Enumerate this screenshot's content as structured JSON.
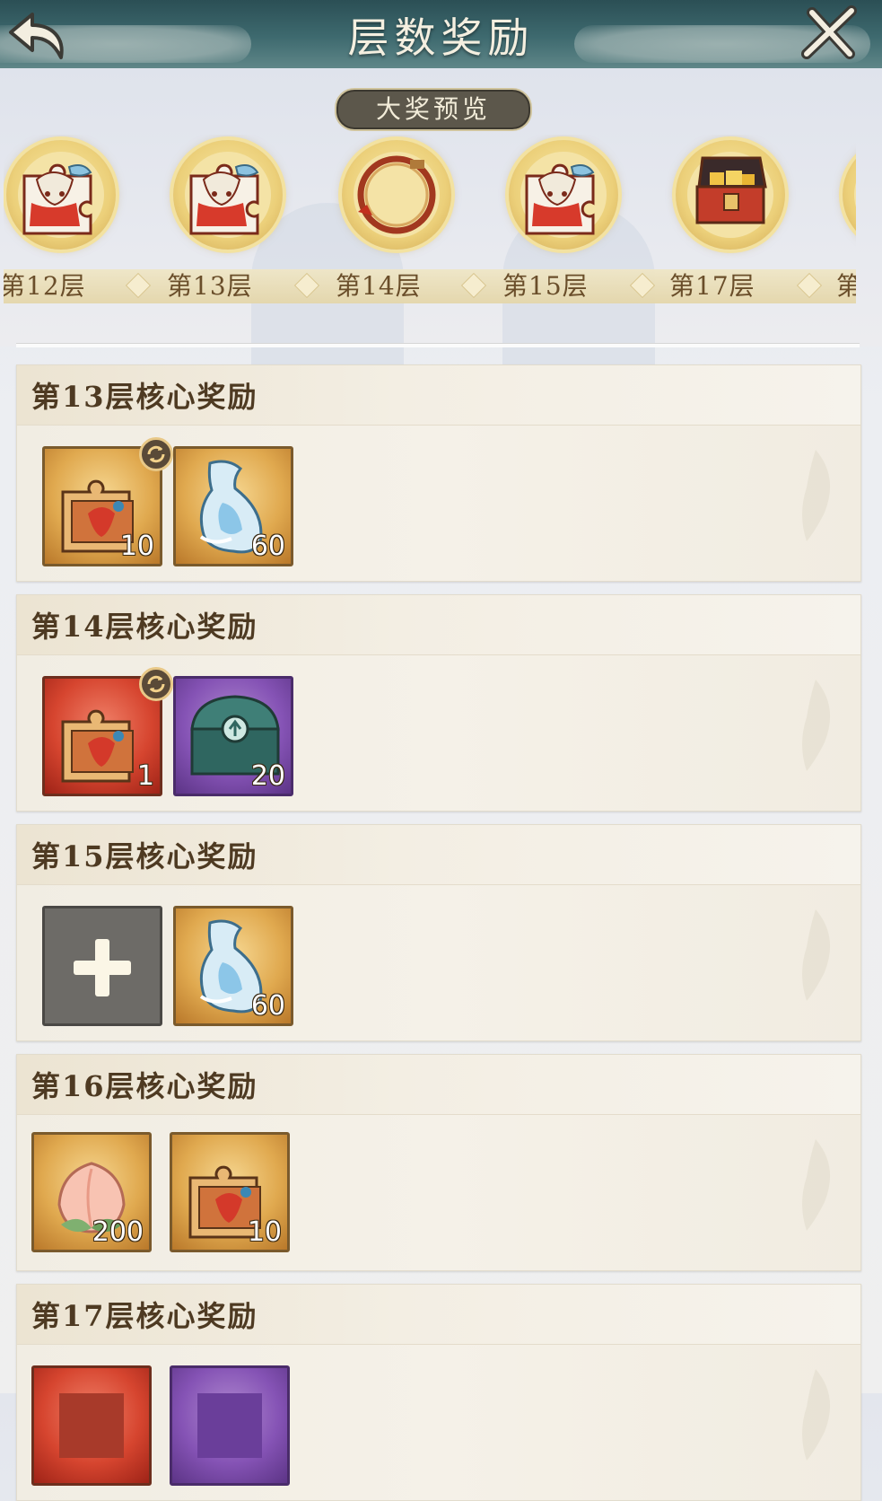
{
  "header": {
    "title": "层数奖励",
    "back_icon": "back-arrow-icon",
    "close_icon": "close-icon",
    "colors": {
      "bar": "#2f5358",
      "title": "#f4efe0"
    }
  },
  "preview": {
    "label": "大奖预览",
    "items": [
      {
        "label": "第12层",
        "icon": "puzzle-portrait-icon"
      },
      {
        "label": "第13层",
        "icon": "puzzle-portrait-icon"
      },
      {
        "label": "第14层",
        "icon": "avatar-frame-icon"
      },
      {
        "label": "第15层",
        "icon": "puzzle-portrait-icon"
      },
      {
        "label": "第17层",
        "icon": "treasure-chest-icon"
      },
      {
        "label": "第",
        "icon": "puzzle-portrait-icon"
      }
    ]
  },
  "rewards": [
    {
      "title": "第13层核心奖励",
      "items": [
        {
          "icon": "puzzle-chest-icon",
          "rarity": "gold",
          "qty": "10",
          "refresh": true
        },
        {
          "icon": "water-vase-icon",
          "rarity": "gold",
          "qty": "60",
          "refresh": false
        }
      ]
    },
    {
      "title": "第14层核心奖励",
      "items": [
        {
          "icon": "puzzle-chest-icon",
          "rarity": "red",
          "qty": "1",
          "refresh": true
        },
        {
          "icon": "green-chest-icon",
          "rarity": "purple",
          "qty": "20",
          "refresh": false
        }
      ]
    },
    {
      "title": "第15层核心奖励",
      "items": [
        {
          "icon": "plus-icon",
          "rarity": "grey",
          "qty": "",
          "refresh": false
        },
        {
          "icon": "water-vase-icon",
          "rarity": "gold",
          "qty": "60",
          "refresh": false
        }
      ]
    },
    {
      "title": "第16层核心奖励",
      "items": [
        {
          "icon": "peach-icon",
          "rarity": "gold",
          "qty": "200",
          "refresh": false
        },
        {
          "icon": "puzzle-chest-icon",
          "rarity": "gold",
          "qty": "10",
          "refresh": false
        }
      ]
    },
    {
      "title": "第17层核心奖励",
      "items": [
        {
          "icon": "red-item-icon",
          "rarity": "red",
          "qty": "",
          "refresh": false
        },
        {
          "icon": "purple-item-icon",
          "rarity": "purple",
          "qty": "",
          "refresh": false
        }
      ]
    }
  ]
}
